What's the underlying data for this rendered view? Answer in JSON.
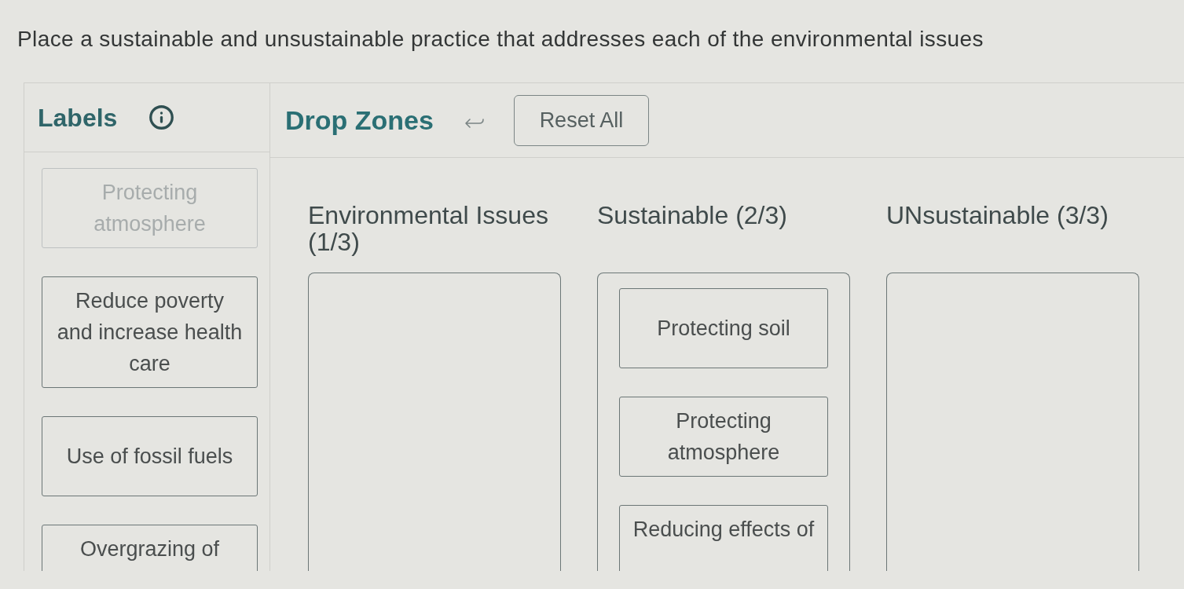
{
  "instruction": "Place a sustainable and unsustainable practice that addresses each of the environmental issues",
  "labels_panel": {
    "title": "Labels",
    "items": [
      {
        "text": "Protecting atmosphere",
        "disabled": true
      },
      {
        "text": "Reduce poverty\nand increase health\ncare",
        "disabled": false
      },
      {
        "text": "Use of fossil fuels",
        "disabled": false
      },
      {
        "text": "Overgrazing of",
        "disabled": false
      }
    ]
  },
  "drop_panel": {
    "title": "Drop Zones",
    "reset_button": "Reset All",
    "zones": [
      {
        "heading": "Environmental Issues (1/3)"
      },
      {
        "heading": "Sustainable (2/3)",
        "items": [
          "Protecting soil",
          "Protecting atmosphere",
          "Reducing effects of"
        ]
      },
      {
        "heading": "UNsustainable (3/3)"
      }
    ]
  }
}
